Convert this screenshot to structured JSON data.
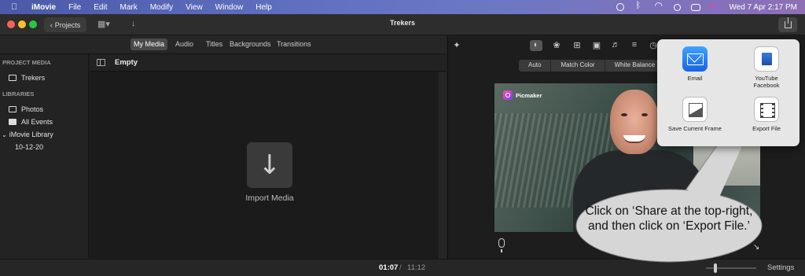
{
  "menubar": {
    "app": "iMovie",
    "items": [
      "File",
      "Edit",
      "Mark",
      "Modify",
      "View",
      "Window",
      "Help"
    ],
    "clock": "Wed 7 Apr  2:17 PM"
  },
  "toolbar": {
    "projects_label": "Projects",
    "title": "Trekers"
  },
  "browser_tabs": [
    "My Media",
    "Audio",
    "Titles",
    "Backgrounds",
    "Transitions"
  ],
  "sidebar": {
    "project_media_heading": "PROJECT MEDIA",
    "project_item": "Trekers",
    "libraries_heading": "LIBRARIES",
    "library_items": [
      "Photos",
      "All Events"
    ],
    "library_name": "iMovie Library",
    "event": "10-12-20"
  },
  "browser": {
    "heading": "Empty",
    "import_label": "Import Media"
  },
  "viewer": {
    "adjust_buttons": [
      "Auto",
      "Match Color",
      "White Balance"
    ],
    "watermark": "Picmaker"
  },
  "timecode": {
    "current": "01:07",
    "separator": "/",
    "total": "11:12"
  },
  "settings_label": "Settings",
  "share_popover": {
    "items": [
      "Email",
      "YouTube\nFacebook",
      "Save Current Frame",
      "Export File"
    ]
  },
  "callout": {
    "text": "Click on ‘Share at the top-right, and then click on ‘Export File.’"
  }
}
